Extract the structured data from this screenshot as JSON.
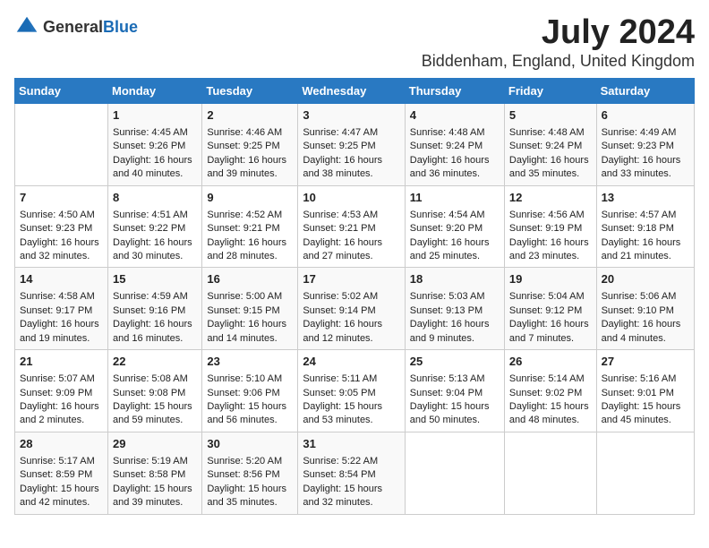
{
  "header": {
    "logo_general": "General",
    "logo_blue": "Blue",
    "month_year": "July 2024",
    "location": "Biddenham, England, United Kingdom"
  },
  "days_of_week": [
    "Sunday",
    "Monday",
    "Tuesday",
    "Wednesday",
    "Thursday",
    "Friday",
    "Saturday"
  ],
  "weeks": [
    [
      {
        "day": "",
        "content": ""
      },
      {
        "day": "1",
        "sunrise": "Sunrise: 4:45 AM",
        "sunset": "Sunset: 9:26 PM",
        "daylight": "Daylight: 16 hours and 40 minutes."
      },
      {
        "day": "2",
        "sunrise": "Sunrise: 4:46 AM",
        "sunset": "Sunset: 9:25 PM",
        "daylight": "Daylight: 16 hours and 39 minutes."
      },
      {
        "day": "3",
        "sunrise": "Sunrise: 4:47 AM",
        "sunset": "Sunset: 9:25 PM",
        "daylight": "Daylight: 16 hours and 38 minutes."
      },
      {
        "day": "4",
        "sunrise": "Sunrise: 4:48 AM",
        "sunset": "Sunset: 9:24 PM",
        "daylight": "Daylight: 16 hours and 36 minutes."
      },
      {
        "day": "5",
        "sunrise": "Sunrise: 4:48 AM",
        "sunset": "Sunset: 9:24 PM",
        "daylight": "Daylight: 16 hours and 35 minutes."
      },
      {
        "day": "6",
        "sunrise": "Sunrise: 4:49 AM",
        "sunset": "Sunset: 9:23 PM",
        "daylight": "Daylight: 16 hours and 33 minutes."
      }
    ],
    [
      {
        "day": "7",
        "sunrise": "Sunrise: 4:50 AM",
        "sunset": "Sunset: 9:23 PM",
        "daylight": "Daylight: 16 hours and 32 minutes."
      },
      {
        "day": "8",
        "sunrise": "Sunrise: 4:51 AM",
        "sunset": "Sunset: 9:22 PM",
        "daylight": "Daylight: 16 hours and 30 minutes."
      },
      {
        "day": "9",
        "sunrise": "Sunrise: 4:52 AM",
        "sunset": "Sunset: 9:21 PM",
        "daylight": "Daylight: 16 hours and 28 minutes."
      },
      {
        "day": "10",
        "sunrise": "Sunrise: 4:53 AM",
        "sunset": "Sunset: 9:21 PM",
        "daylight": "Daylight: 16 hours and 27 minutes."
      },
      {
        "day": "11",
        "sunrise": "Sunrise: 4:54 AM",
        "sunset": "Sunset: 9:20 PM",
        "daylight": "Daylight: 16 hours and 25 minutes."
      },
      {
        "day": "12",
        "sunrise": "Sunrise: 4:56 AM",
        "sunset": "Sunset: 9:19 PM",
        "daylight": "Daylight: 16 hours and 23 minutes."
      },
      {
        "day": "13",
        "sunrise": "Sunrise: 4:57 AM",
        "sunset": "Sunset: 9:18 PM",
        "daylight": "Daylight: 16 hours and 21 minutes."
      }
    ],
    [
      {
        "day": "14",
        "sunrise": "Sunrise: 4:58 AM",
        "sunset": "Sunset: 9:17 PM",
        "daylight": "Daylight: 16 hours and 19 minutes."
      },
      {
        "day": "15",
        "sunrise": "Sunrise: 4:59 AM",
        "sunset": "Sunset: 9:16 PM",
        "daylight": "Daylight: 16 hours and 16 minutes."
      },
      {
        "day": "16",
        "sunrise": "Sunrise: 5:00 AM",
        "sunset": "Sunset: 9:15 PM",
        "daylight": "Daylight: 16 hours and 14 minutes."
      },
      {
        "day": "17",
        "sunrise": "Sunrise: 5:02 AM",
        "sunset": "Sunset: 9:14 PM",
        "daylight": "Daylight: 16 hours and 12 minutes."
      },
      {
        "day": "18",
        "sunrise": "Sunrise: 5:03 AM",
        "sunset": "Sunset: 9:13 PM",
        "daylight": "Daylight: 16 hours and 9 minutes."
      },
      {
        "day": "19",
        "sunrise": "Sunrise: 5:04 AM",
        "sunset": "Sunset: 9:12 PM",
        "daylight": "Daylight: 16 hours and 7 minutes."
      },
      {
        "day": "20",
        "sunrise": "Sunrise: 5:06 AM",
        "sunset": "Sunset: 9:10 PM",
        "daylight": "Daylight: 16 hours and 4 minutes."
      }
    ],
    [
      {
        "day": "21",
        "sunrise": "Sunrise: 5:07 AM",
        "sunset": "Sunset: 9:09 PM",
        "daylight": "Daylight: 16 hours and 2 minutes."
      },
      {
        "day": "22",
        "sunrise": "Sunrise: 5:08 AM",
        "sunset": "Sunset: 9:08 PM",
        "daylight": "Daylight: 15 hours and 59 minutes."
      },
      {
        "day": "23",
        "sunrise": "Sunrise: 5:10 AM",
        "sunset": "Sunset: 9:06 PM",
        "daylight": "Daylight: 15 hours and 56 minutes."
      },
      {
        "day": "24",
        "sunrise": "Sunrise: 5:11 AM",
        "sunset": "Sunset: 9:05 PM",
        "daylight": "Daylight: 15 hours and 53 minutes."
      },
      {
        "day": "25",
        "sunrise": "Sunrise: 5:13 AM",
        "sunset": "Sunset: 9:04 PM",
        "daylight": "Daylight: 15 hours and 50 minutes."
      },
      {
        "day": "26",
        "sunrise": "Sunrise: 5:14 AM",
        "sunset": "Sunset: 9:02 PM",
        "daylight": "Daylight: 15 hours and 48 minutes."
      },
      {
        "day": "27",
        "sunrise": "Sunrise: 5:16 AM",
        "sunset": "Sunset: 9:01 PM",
        "daylight": "Daylight: 15 hours and 45 minutes."
      }
    ],
    [
      {
        "day": "28",
        "sunrise": "Sunrise: 5:17 AM",
        "sunset": "Sunset: 8:59 PM",
        "daylight": "Daylight: 15 hours and 42 minutes."
      },
      {
        "day": "29",
        "sunrise": "Sunrise: 5:19 AM",
        "sunset": "Sunset: 8:58 PM",
        "daylight": "Daylight: 15 hours and 39 minutes."
      },
      {
        "day": "30",
        "sunrise": "Sunrise: 5:20 AM",
        "sunset": "Sunset: 8:56 PM",
        "daylight": "Daylight: 15 hours and 35 minutes."
      },
      {
        "day": "31",
        "sunrise": "Sunrise: 5:22 AM",
        "sunset": "Sunset: 8:54 PM",
        "daylight": "Daylight: 15 hours and 32 minutes."
      },
      {
        "day": "",
        "content": ""
      },
      {
        "day": "",
        "content": ""
      },
      {
        "day": "",
        "content": ""
      }
    ]
  ]
}
